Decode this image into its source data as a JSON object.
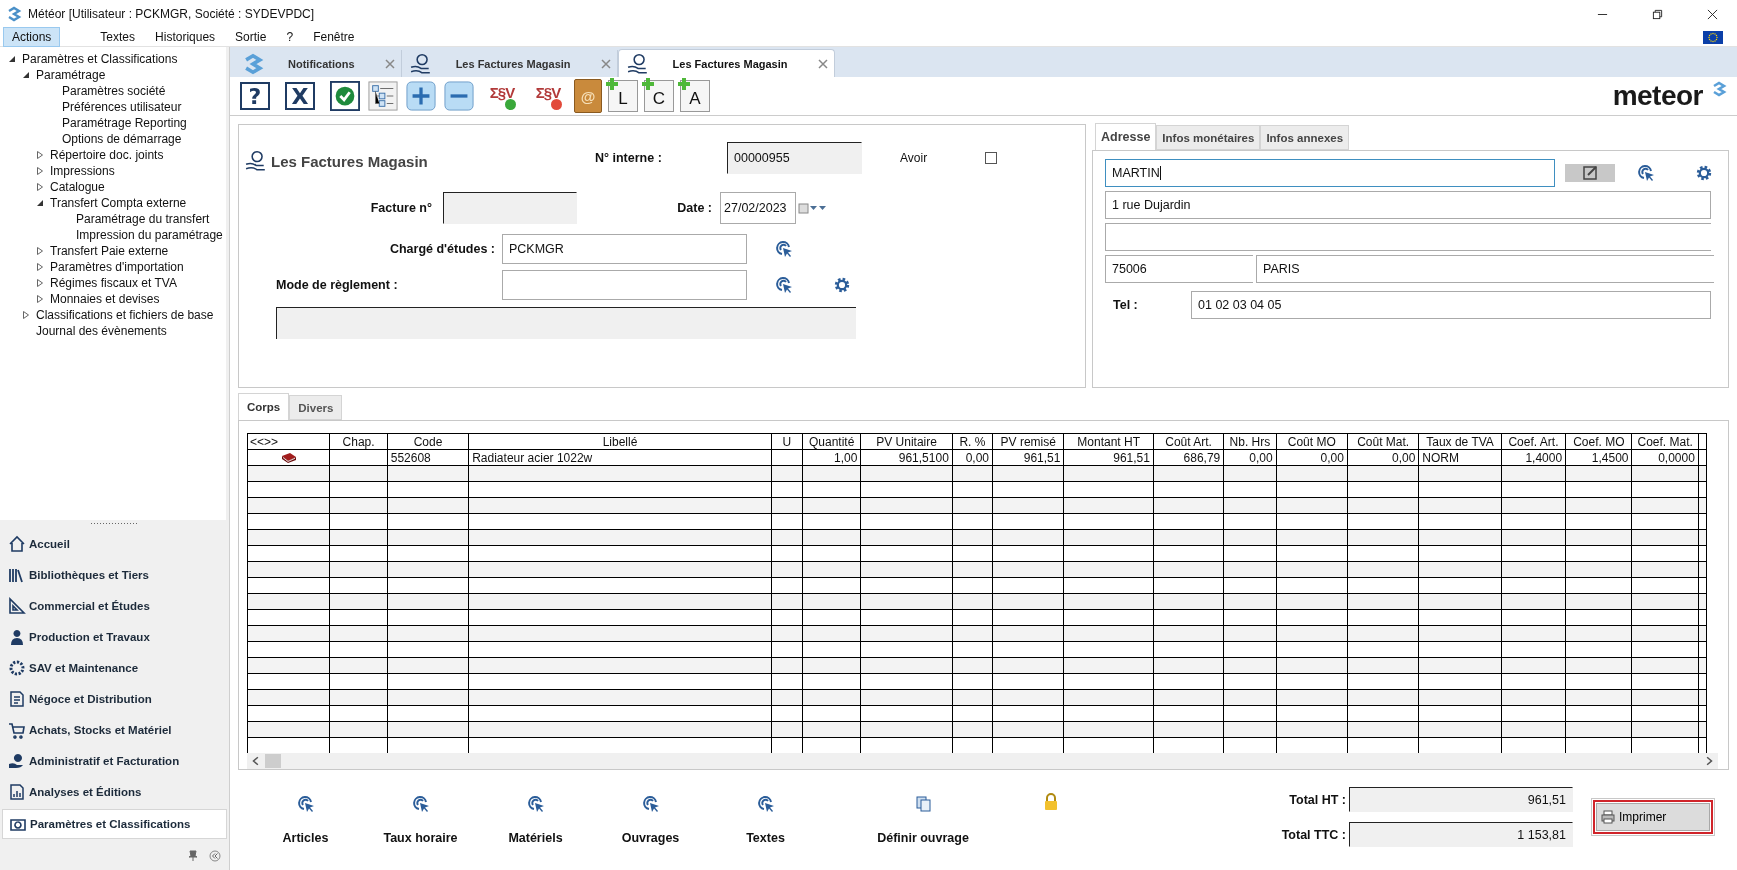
{
  "window": {
    "title": "Météor [Utilisateur : PCKMGR, Société : SYDEVPDC]"
  },
  "menu": [
    {
      "label": "Actions",
      "selected": true
    },
    {
      "label": "Textes",
      "selected": false
    },
    {
      "label": "Historiques",
      "selected": false
    },
    {
      "label": "Sortie",
      "selected": false
    },
    {
      "label": "?",
      "selected": false
    },
    {
      "label": "Fenêtre",
      "selected": false
    }
  ],
  "tree": [
    {
      "label": "Paramètres et Classifications",
      "expanded": true,
      "children": [
        {
          "label": "Paramétrage",
          "expanded": true,
          "children": [
            {
              "label": "Paramètres société"
            },
            {
              "label": "Préférences utilisateur"
            },
            {
              "label": "Paramétrage Reporting"
            },
            {
              "label": "Options de démarrage"
            },
            {
              "label": "Répertoire doc. joints",
              "expanded": false
            },
            {
              "label": "Impressions",
              "expanded": false
            },
            {
              "label": "Catalogue",
              "expanded": false
            },
            {
              "label": "Transfert Compta externe",
              "expanded": true,
              "children": [
                {
                  "label": "Paramétrage du transfert"
                },
                {
                  "label": "Impression du paramétrage"
                }
              ]
            },
            {
              "label": "Transfert Paie externe",
              "expanded": false
            },
            {
              "label": "Paramètres d'importation",
              "expanded": false
            },
            {
              "label": "Régimes fiscaux et TVA",
              "expanded": false
            },
            {
              "label": "Monnaies et devises",
              "expanded": false
            }
          ]
        },
        {
          "label": "Classifications et fichiers de base",
          "expanded": false
        },
        {
          "label": "Journal des évènements"
        }
      ]
    }
  ],
  "nav": [
    {
      "label": "Accueil",
      "selected": false
    },
    {
      "label": "Bibliothèques et Tiers",
      "selected": false
    },
    {
      "label": "Commercial et Études",
      "selected": false
    },
    {
      "label": "Production et Travaux",
      "selected": false
    },
    {
      "label": "SAV et Maintenance",
      "selected": false
    },
    {
      "label": "Négoce et Distribution",
      "selected": false
    },
    {
      "label": "Achats, Stocks et Matériel",
      "selected": false
    },
    {
      "label": "Administratif et Facturation",
      "selected": false
    },
    {
      "label": "Analyses et Éditions",
      "selected": false
    },
    {
      "label": "Paramètres et Classifications",
      "selected": true
    }
  ],
  "doc_tabs": [
    {
      "label": "Notifications",
      "kind": "notifications",
      "selected": false
    },
    {
      "label": "Les Factures Magasin",
      "kind": "invoice",
      "selected": false
    },
    {
      "label": "Les Factures Magasin",
      "kind": "invoice",
      "selected": true
    }
  ],
  "toolbar": [
    {
      "kind": "framed",
      "glyph": "?"
    },
    {
      "kind": "framed",
      "glyph": "X"
    },
    {
      "kind": "check"
    },
    {
      "kind": "tree"
    },
    {
      "kind": "plus"
    },
    {
      "kind": "minus"
    },
    {
      "kind": "sum-add",
      "glyph": "Σ§V"
    },
    {
      "kind": "sum-remove",
      "glyph": "Σ§V"
    },
    {
      "kind": "address-book",
      "glyph": "@"
    },
    {
      "kind": "add-doc",
      "glyph": "L"
    },
    {
      "kind": "add-doc",
      "glyph": "C"
    },
    {
      "kind": "add-doc",
      "glyph": "A"
    }
  ],
  "logo": "meteor",
  "form": {
    "title": "Les Factures Magasin",
    "internal_no_label": "N° interne :",
    "internal_no": "00000955",
    "avoir_label": "Avoir",
    "avoir_checked": false,
    "invoice_no_label": "Facture n°",
    "date_label": "Date :",
    "date": "27/02/2023",
    "manager_label": "Chargé d'études :",
    "manager": "PCKMGR",
    "payment_label": "Mode de règlement :"
  },
  "address_tabs": [
    {
      "label": "Adresse",
      "selected": true
    },
    {
      "label": "Infos monétaires",
      "selected": false
    },
    {
      "label": "Infos annexes",
      "selected": false
    }
  ],
  "address": {
    "name": "MARTIN",
    "line1": "1 rue Dujardin",
    "postcode": "75006",
    "city": "PARIS",
    "tel_label": "Tel :",
    "tel": "01 02 03 04 05"
  },
  "body_tabs": [
    {
      "label": "Corps",
      "selected": true
    },
    {
      "label": "Divers",
      "selected": false
    }
  ],
  "table": {
    "nav": "<<>>",
    "columns": [
      "Chap.",
      "Code",
      "Libellé",
      "U",
      "Quantité",
      "PV Unitaire",
      "R. %",
      "PV remisé",
      "Montant HT",
      "Coût Art.",
      "Nb. Hrs",
      "Coût MO",
      "Coût Mat.",
      "Taux de TVA",
      "Coef. Art.",
      "Coef. MO",
      "Coef. Mat."
    ],
    "rows": [
      {
        "cells": [
          null,
          "552608",
          "Radiateur acier 1022w",
          null,
          "1,00",
          "961,5100",
          "0,00",
          "961,51",
          "961,51",
          "686,79",
          "0,00",
          "0,00",
          "0,00",
          "NORM",
          "1,4000",
          "1,4500",
          "0,0000"
        ]
      }
    ]
  },
  "actions": [
    {
      "label": "Articles",
      "kind": "pick"
    },
    {
      "label": "Taux horaire",
      "kind": "pick"
    },
    {
      "label": "Matériels",
      "kind": "pick"
    },
    {
      "label": "Ouvrages",
      "kind": "pick"
    },
    {
      "label": "Textes",
      "kind": "pick"
    },
    {
      "label": "Définir ouvrage",
      "kind": "copy"
    }
  ],
  "totals": [
    {
      "label": "Total HT :",
      "value": "961,51"
    },
    {
      "label": "Total TTC :",
      "value": "1 153,81"
    }
  ],
  "print_button": "Imprimer"
}
